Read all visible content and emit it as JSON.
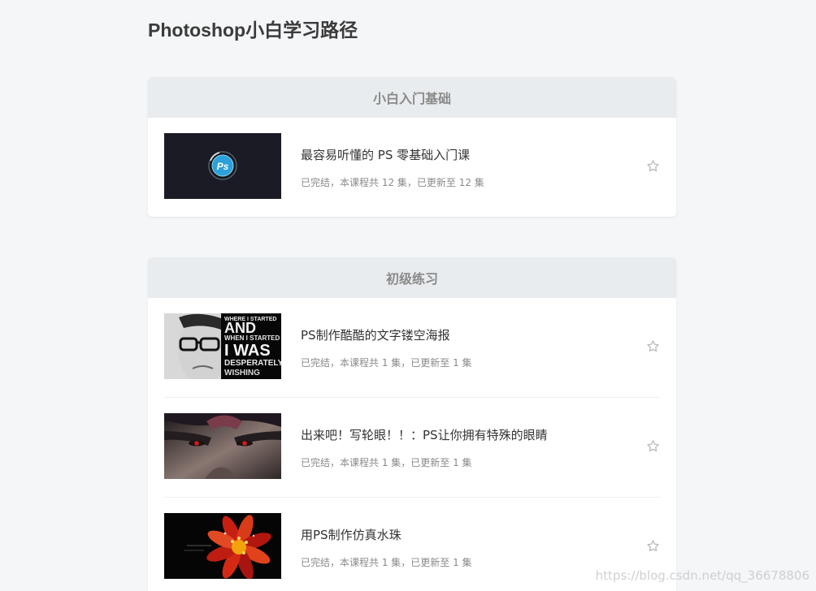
{
  "page_title": "Photoshop小白学习路径",
  "sections": [
    {
      "title": "小白入门基础",
      "courses": [
        {
          "title": "最容易听懂的 PS 零基础入门课",
          "meta": "已完结，本课程共 12 集，已更新至 12 集",
          "thumb_text": "Ps"
        }
      ]
    },
    {
      "title": "初级练习",
      "courses": [
        {
          "title": "PS制作酷酷的文字镂空海报",
          "meta": "已完结，本课程共 1 集，已更新至 1 集",
          "thumb_text": [
            "WHERE I STARTED",
            "AND",
            "WHEN I STARTED",
            "I WAS",
            "DESPERATELY",
            "WISHING"
          ]
        },
        {
          "title": "出来吧！写轮眼！！：PS让你拥有特殊的眼睛",
          "meta": "已完结，本课程共 1 集，已更新至 1 集"
        },
        {
          "title": "用PS制作仿真水珠",
          "meta": "已完结，本课程共 1 集，已更新至 1 集"
        }
      ]
    }
  ],
  "watermark": "https://blog.csdn.net/qq_36678806",
  "colors": {
    "background": "#f5f6f8",
    "section_header": "#e8ecee",
    "title": "#3b3b3b",
    "meta": "#8a8a8a",
    "star": "#b8b8b8"
  },
  "icons": {
    "favorite": "star-outline-icon"
  }
}
